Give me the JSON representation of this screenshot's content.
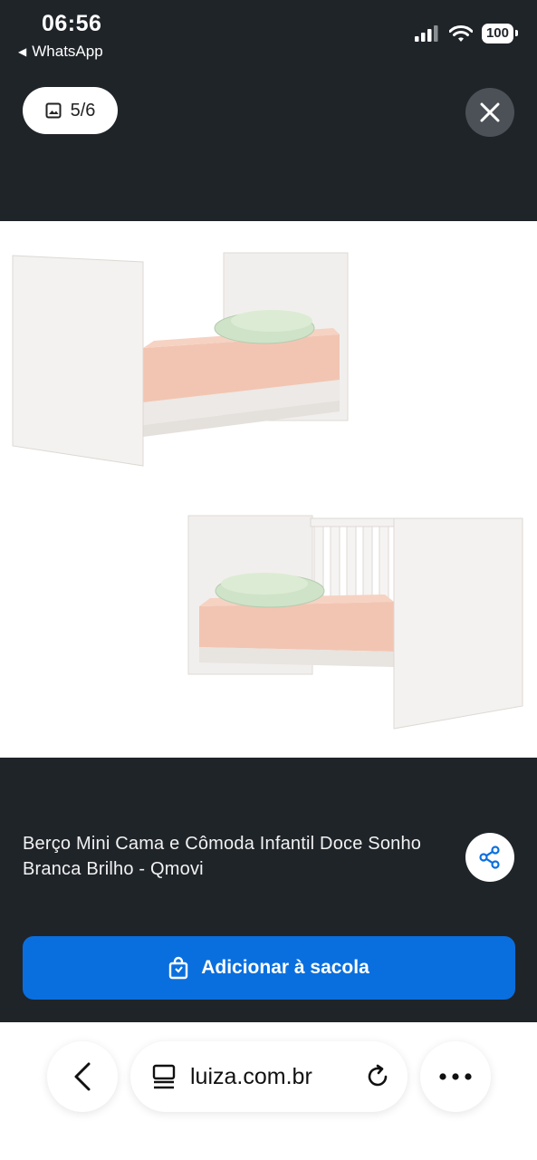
{
  "status_bar": {
    "time": "06:56",
    "back_app": "WhatsApp",
    "battery": "100"
  },
  "gallery": {
    "counter": "5/6",
    "colors": {
      "background": "#1f2429",
      "image_bg": "#ffffff"
    }
  },
  "product": {
    "title": "Berço Mini Cama e Cômoda Infantil Doce Sonho Branca Brilho - Qmovi"
  },
  "actions": {
    "add_to_bag": "Adicionar à sacola",
    "accent_color": "#0a6fde"
  },
  "browser": {
    "url": "luiza.com.br"
  },
  "icons": {
    "gallery": "image-icon",
    "close": "close-icon",
    "share": "share-icon",
    "bag": "shopping-bag-icon",
    "back": "chevron-left-icon",
    "tabs": "tabs-icon",
    "reload": "reload-icon",
    "more": "more-icon"
  }
}
